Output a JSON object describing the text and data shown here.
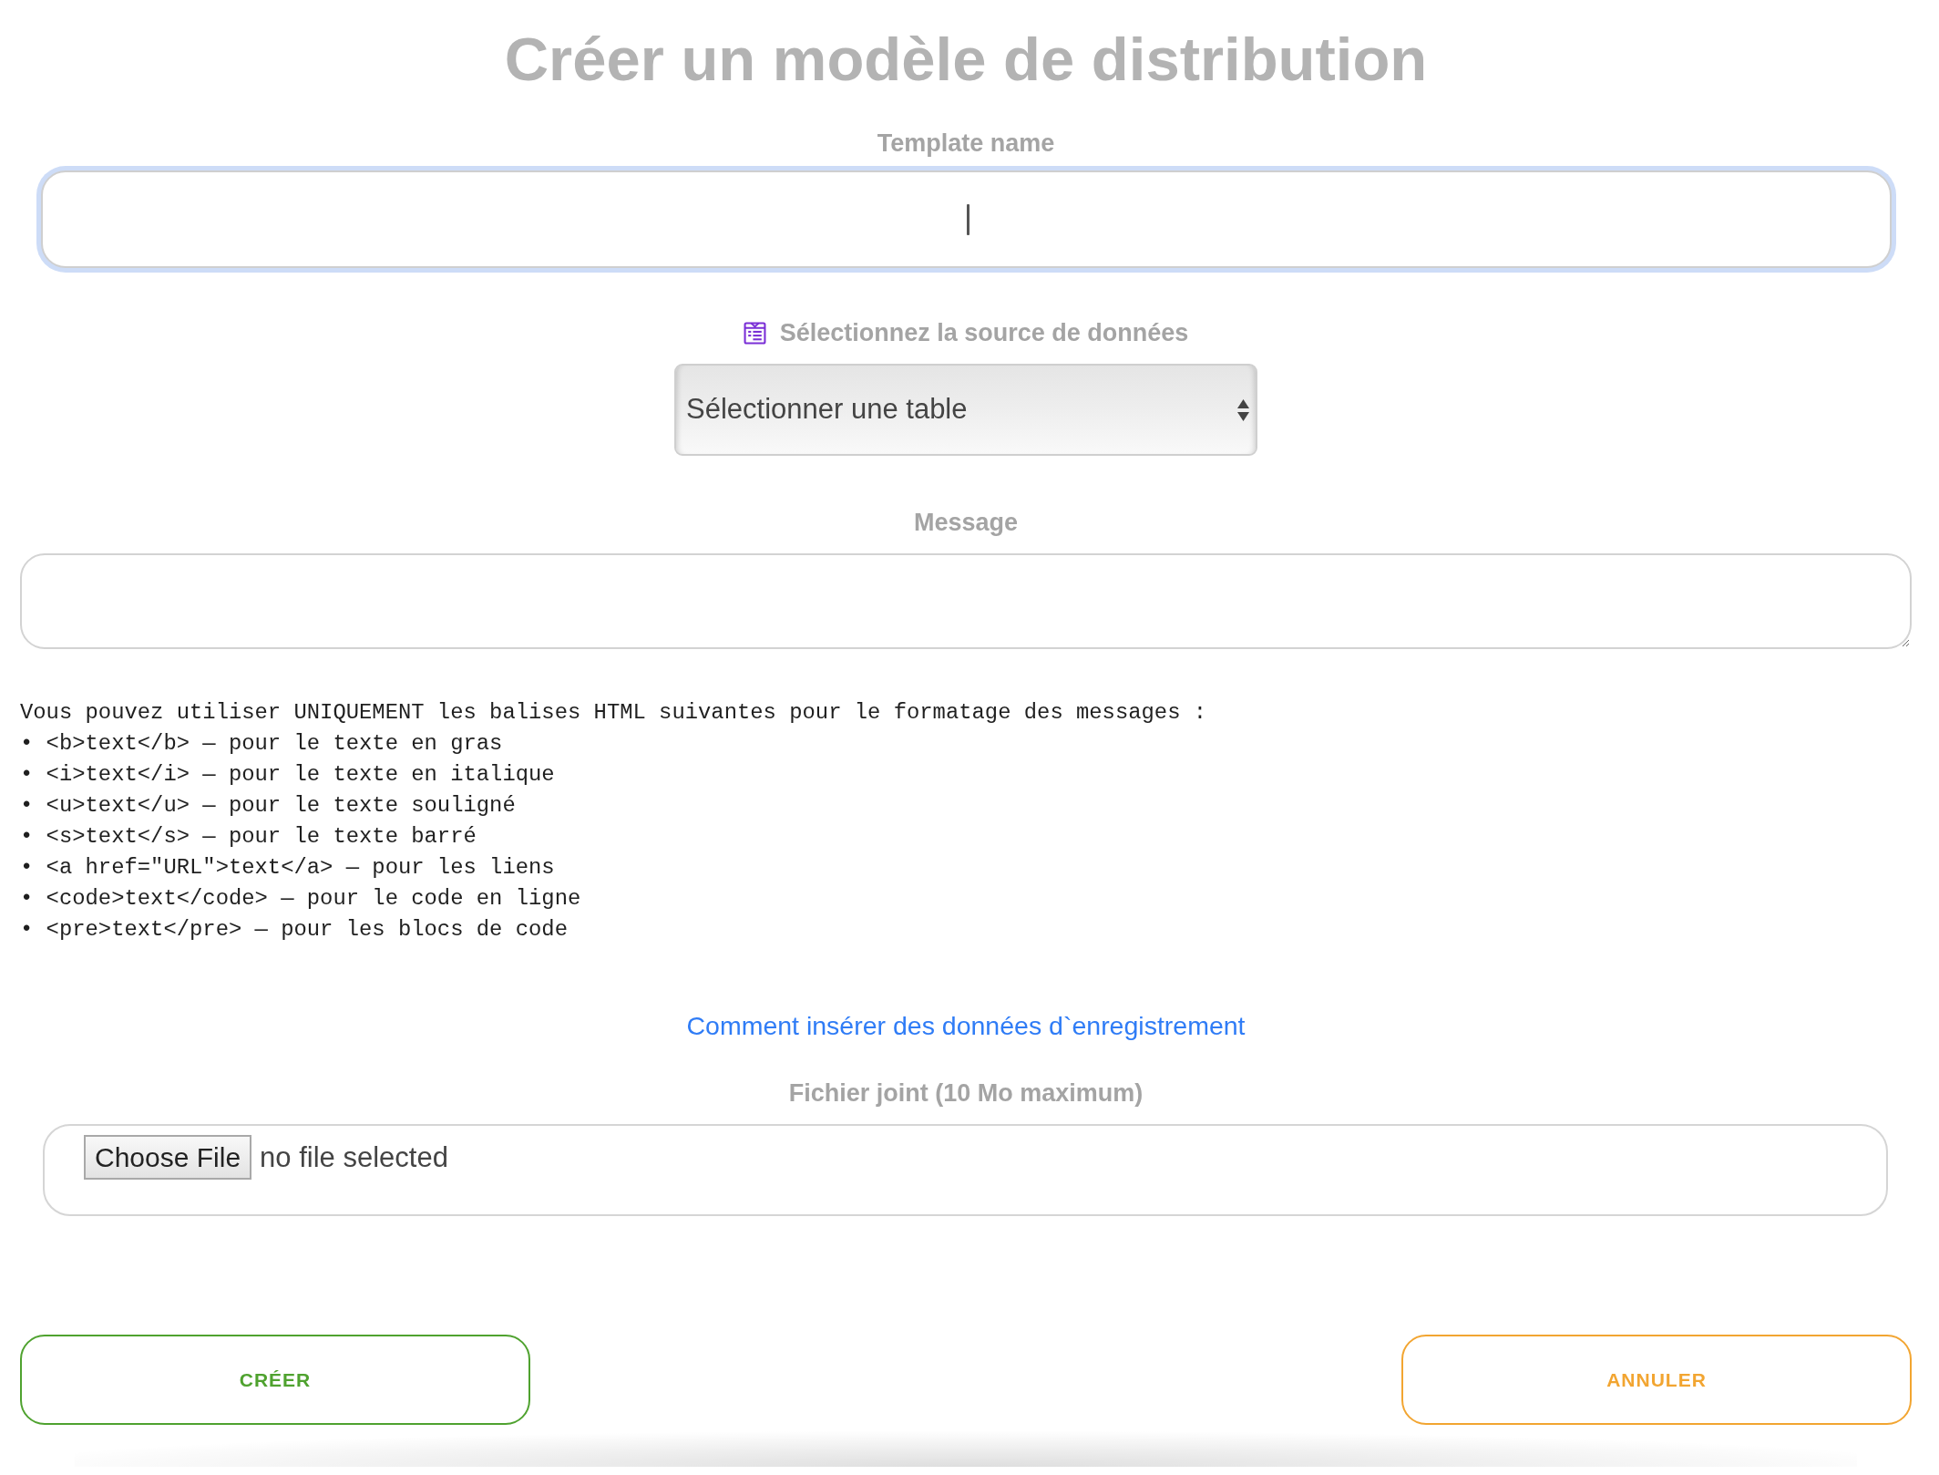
{
  "title": "Créer un modèle de distribution",
  "template_name": {
    "label": "Template name",
    "focused": true
  },
  "data_source": {
    "label": "Sélectionnez la source de données",
    "value": "Sélectionner une table"
  },
  "message": {
    "label": "Message"
  },
  "formatting_help": {
    "intro": "Vous pouvez utiliser UNIQUEMENT les balises HTML suivantes pour le formatage des messages :",
    "items": [
      "• <b>text</b> — pour le texte en gras",
      "• <i>text</i> — pour le texte en italique",
      "• <u>text</u> — pour le texte souligné",
      "• <s>text</s> — pour le texte barré",
      "• <a href=\"URL\">text</a> — pour les liens",
      "• <code>text</code> — pour le code en ligne",
      "• <pre>text</pre> — pour les blocs de code"
    ]
  },
  "help_link": "Comment insérer des données d`enregistrement",
  "attachment": {
    "label": "Fichier joint (10 Mo maximum)",
    "button": "Choose File",
    "status": "no file selected"
  },
  "buttons": [
    {
      "label": "CRÉER",
      "kind": "confirm"
    },
    {
      "label": "ANNULER",
      "kind": "cancel"
    }
  ]
}
